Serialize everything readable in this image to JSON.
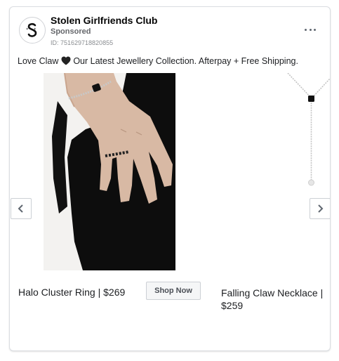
{
  "page": {
    "name": "Stolen Girlfriends Club",
    "sponsored": "Sponsored",
    "ad_id": "ID: 751629718820855"
  },
  "post": {
    "caption_before": "Love Claw ",
    "caption_after": " Our Latest Jewellery Collection. Afterpay + Free Shipping."
  },
  "carousel": {
    "cards": [
      {
        "title": "Halo Cluster Ring | $269",
        "cta": "Shop Now"
      },
      {
        "title": "Falling Claw Necklace | $259"
      }
    ]
  },
  "icons": {
    "avatar": "stolen-girlfriends-logo-icon",
    "more": "more-options-icon",
    "heart": "black-heart-icon",
    "prev": "chevron-left-icon",
    "next": "chevron-right-icon"
  },
  "colors": {
    "accent_text": "#1c1e21",
    "muted": "#65676b",
    "border": "#dadde1"
  }
}
